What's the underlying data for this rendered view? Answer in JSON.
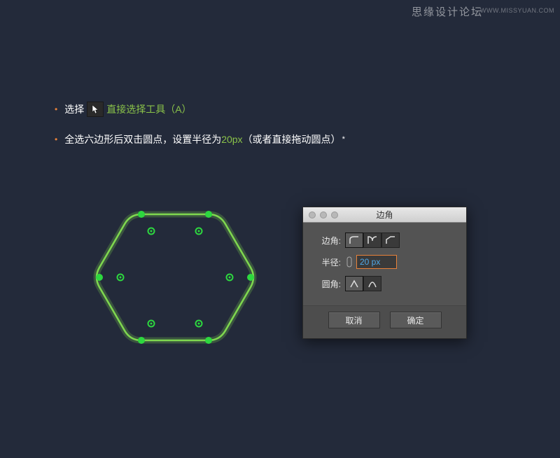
{
  "watermark": {
    "cn": "思缘设计论坛",
    "en": "WWW.MISSYUAN.COM"
  },
  "line1": {
    "pre": "选择",
    "tool": "直接选择工具（A）"
  },
  "line2": {
    "pre": "全选六边形后双击圆点，设置半径为",
    "radius": "20px",
    "post": "（或者直接拖动圆点）",
    "sup": "*"
  },
  "dialog": {
    "title": "边角",
    "labels": {
      "corner": "边角:",
      "radius": "半径:",
      "round": "圆角:"
    },
    "radius_value": "20 px",
    "buttons": {
      "cancel": "取消",
      "ok": "确定"
    }
  }
}
